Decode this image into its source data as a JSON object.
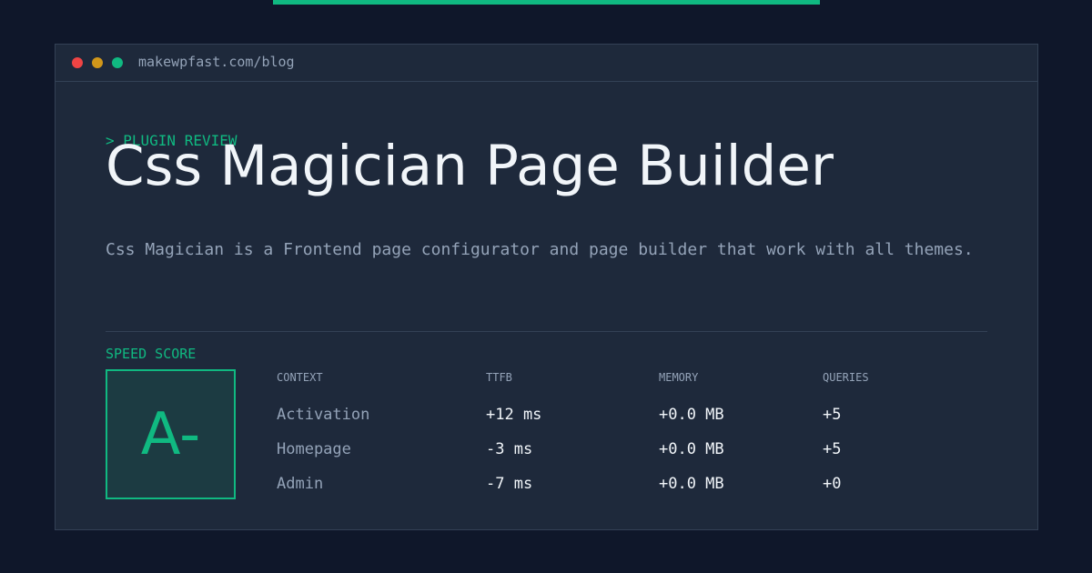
{
  "window": {
    "url": "makewpfast.com/blog"
  },
  "article": {
    "kicker": "> PLUGIN REVIEW",
    "title": "Css Magician Page Builder",
    "description": "Css Magician is a Frontend page configurator and page builder that work with all themes."
  },
  "score": {
    "label": "SPEED SCORE",
    "grade": "A-"
  },
  "table": {
    "headers": [
      "CONTEXT",
      "TTFB",
      "MEMORY",
      "QUERIES"
    ],
    "rows": [
      [
        "Activation",
        "+12 ms",
        "+0.0 MB",
        "+5"
      ],
      [
        "Homepage",
        "-3 ms",
        "+0.0 MB",
        "+5"
      ],
      [
        "Admin",
        "-7 ms",
        "+0.0 MB",
        "+0"
      ]
    ]
  },
  "colors": {
    "accent": "#10b981",
    "background": "#0f172a",
    "panel": "#1e293b",
    "text": "#f1f5f9",
    "muted": "#94a3b8"
  }
}
